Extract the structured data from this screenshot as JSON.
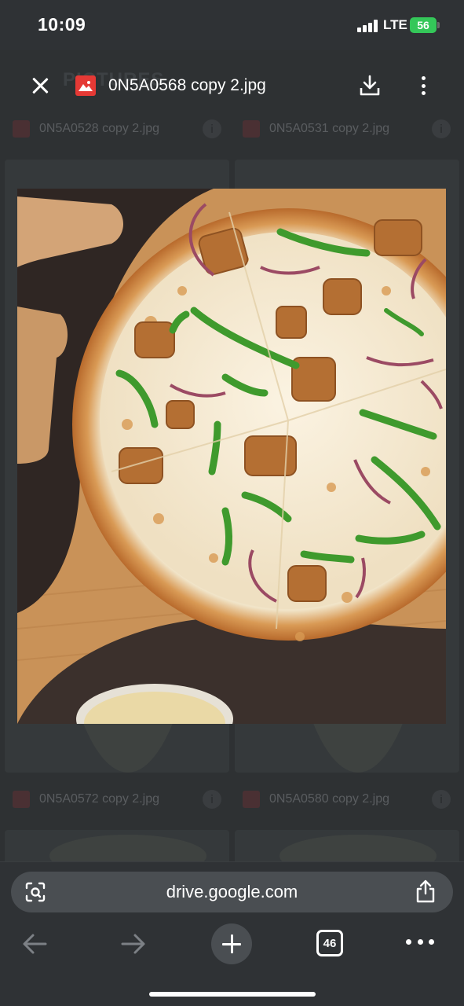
{
  "status_bar": {
    "time": "10:09",
    "network": "LTE",
    "battery": "56"
  },
  "viewer": {
    "file_name": "0N5A0568 copy 2.jpg",
    "close_icon": "close-icon",
    "download_icon": "download-icon",
    "more_icon": "more-vertical-icon"
  },
  "drive_background": {
    "folder_title": "PICTURES",
    "files": [
      {
        "name": "0N5A0528 copy 2.jpg"
      },
      {
        "name": "0N5A0531 copy 2.jpg"
      },
      {
        "name": "0N5A0572 copy 2.jpg"
      },
      {
        "name": "0N5A0580 copy 2.jpg"
      }
    ]
  },
  "browser": {
    "url": "drive.google.com",
    "tab_count": "46",
    "icons": [
      "lens-icon",
      "share-icon",
      "back-arrow-icon",
      "forward-arrow-icon",
      "plus-icon",
      "tabs-icon",
      "more-horizontal-icon"
    ]
  },
  "colors": {
    "status_background": "#2f3235",
    "battery": "#34c759",
    "file_icon": "#e53935",
    "url_bar": "#4a4e52"
  }
}
